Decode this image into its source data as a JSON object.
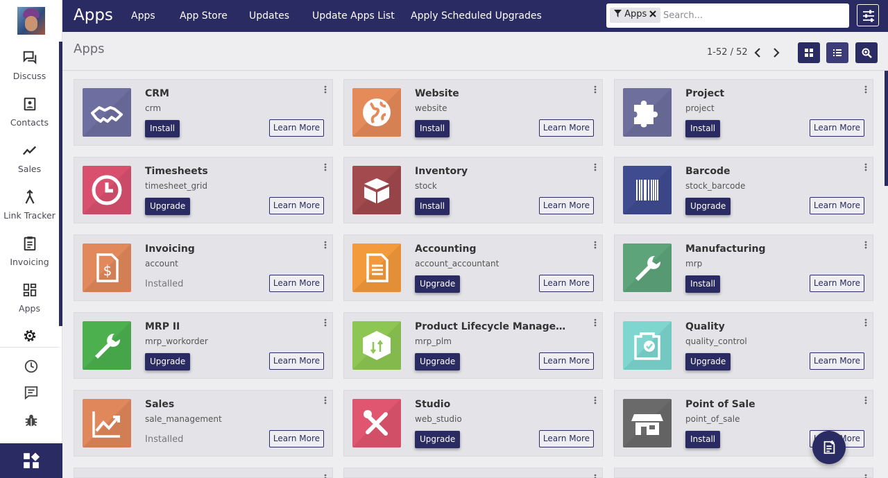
{
  "nav": {
    "brand": "Apps",
    "links": [
      "Apps",
      "App Store",
      "Updates",
      "Update Apps List",
      "Apply Scheduled Upgrades"
    ]
  },
  "search": {
    "facet": "Apps",
    "placeholder": "Search..."
  },
  "sidebar": {
    "items": [
      {
        "label": "Discuss",
        "icon": "chat-icon"
      },
      {
        "label": "Contacts",
        "icon": "contacts-icon"
      },
      {
        "label": "Sales",
        "icon": "sales-chart-icon"
      },
      {
        "label": "Link Tracker",
        "icon": "link-tracker-icon"
      },
      {
        "label": "Invoicing",
        "icon": "clipboard-icon"
      },
      {
        "label": "Apps",
        "icon": "apps-grid-icon"
      }
    ]
  },
  "control": {
    "title": "Apps",
    "pager": "1-52 / 52"
  },
  "cards": [
    {
      "name": "CRM",
      "tech": "crm",
      "action": "Install",
      "more": "Learn More",
      "color": "#6e6fa0",
      "icon": "handshake-icon"
    },
    {
      "name": "Website",
      "tech": "website",
      "action": "Install",
      "more": "Learn More",
      "color": "#e58b5a",
      "icon": "globe-icon"
    },
    {
      "name": "Project",
      "tech": "project",
      "action": "Install",
      "more": "Learn More",
      "color": "#6f6f9e",
      "icon": "puzzle-icon"
    },
    {
      "name": "Timesheets",
      "tech": "timesheet_grid",
      "action": "Upgrade",
      "more": "Learn More",
      "color": "#d9506f",
      "icon": "clock-icon"
    },
    {
      "name": "Inventory",
      "tech": "stock",
      "action": "Install",
      "more": "Learn More",
      "color": "#a24a4e",
      "icon": "box-icon"
    },
    {
      "name": "Barcode",
      "tech": "stock_barcode",
      "action": "Upgrade",
      "more": "Learn More",
      "color": "#3f4c8f",
      "icon": "barcode-icon"
    },
    {
      "name": "Invoicing",
      "tech": "account",
      "status": "Installed",
      "more": "Learn More",
      "color": "#e2895c",
      "icon": "invoice-icon"
    },
    {
      "name": "Accounting",
      "tech": "account_accountant",
      "action": "Upgrade",
      "more": "Learn More",
      "color": "#f29a3c",
      "icon": "document-icon"
    },
    {
      "name": "Manufacturing",
      "tech": "mrp",
      "action": "Install",
      "more": "Learn More",
      "color": "#5ea47a",
      "icon": "wrench-icon"
    },
    {
      "name": "MRP II",
      "tech": "mrp_workorder",
      "action": "Upgrade",
      "more": "Learn More",
      "color": "#4cb04f",
      "icon": "wrench-icon"
    },
    {
      "name": "Product Lifecycle Management (...",
      "tech": "mrp_plm",
      "action": "Upgrade",
      "more": "Learn More",
      "color": "#8dc652",
      "icon": "cube-icon"
    },
    {
      "name": "Quality",
      "tech": "quality_control",
      "action": "Upgrade",
      "more": "Learn More",
      "color": "#7ed6cf",
      "icon": "quality-check-icon"
    },
    {
      "name": "Sales",
      "tech": "sale_management",
      "status": "Installed",
      "more": "Learn More",
      "color": "#e0885c",
      "icon": "trend-chart-icon"
    },
    {
      "name": "Studio",
      "tech": "web_studio",
      "action": "Upgrade",
      "more": "Learn More",
      "color": "#e05670",
      "icon": "tools-icon"
    },
    {
      "name": "Point of Sale",
      "tech": "point_of_sale",
      "action": "Install",
      "more": "Learn More",
      "color": "#6a6a6a",
      "icon": "store-icon"
    }
  ]
}
